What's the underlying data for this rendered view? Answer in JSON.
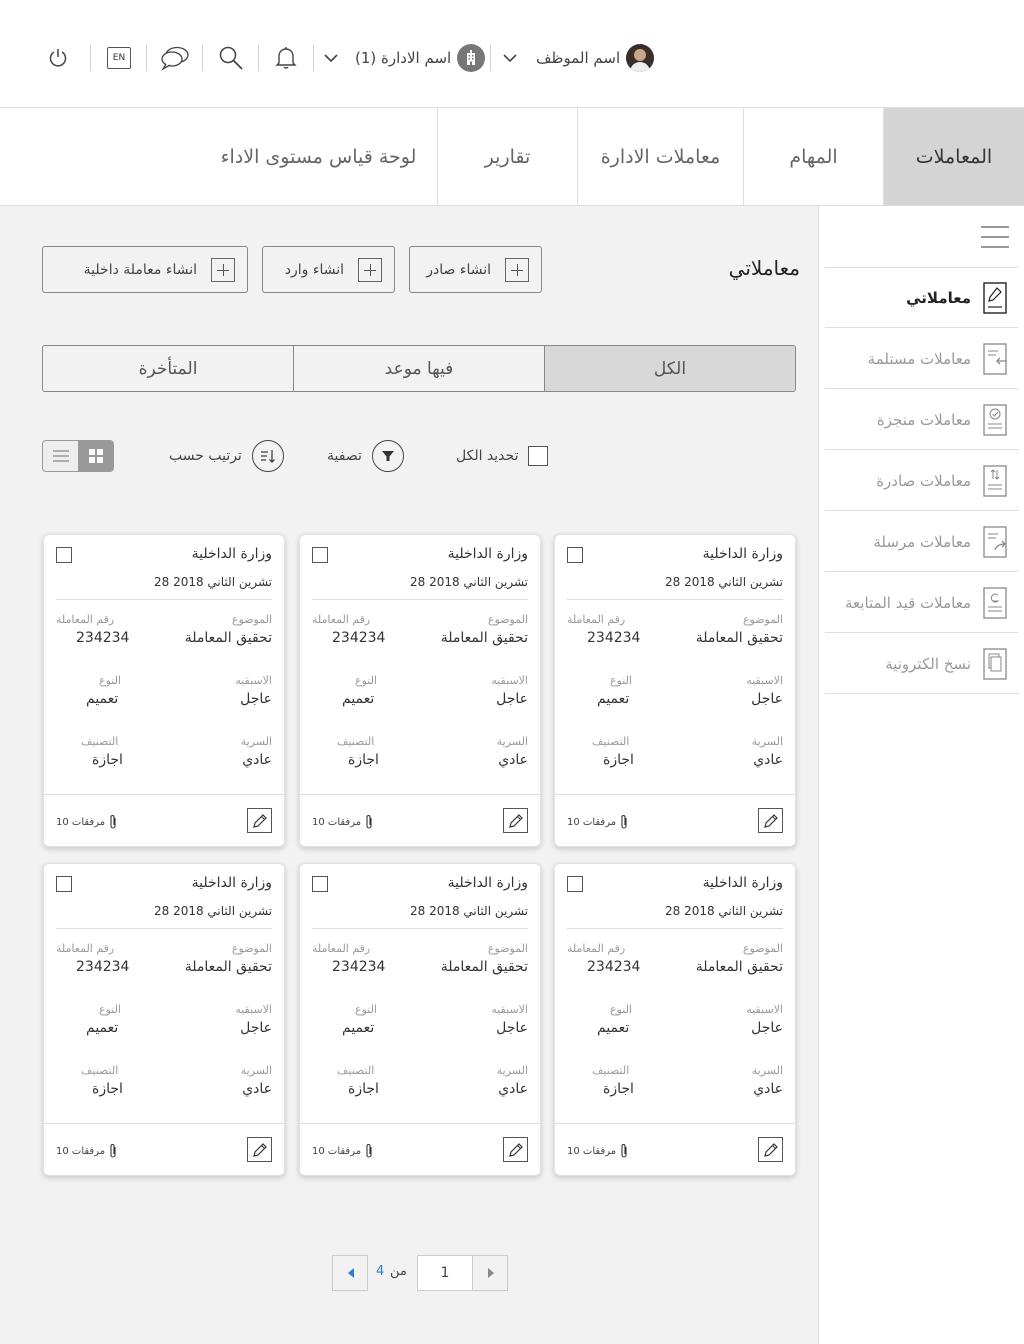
{
  "header": {
    "employee_name": "اسم الموظف",
    "department_name": "اسم الادارة (1)",
    "language": "EN"
  },
  "main_tabs": [
    {
      "label": "المعاملات",
      "active": true
    },
    {
      "label": "المهام",
      "active": false
    },
    {
      "label": "معاملات الادارة",
      "active": false
    },
    {
      "label": "تقارير",
      "active": false
    },
    {
      "label": "لوحة قياس مستوى الاداء",
      "active": false
    }
  ],
  "sidebar": {
    "items": [
      {
        "label": "معاملاتي",
        "icon": "document-edit-icon",
        "active": true
      },
      {
        "label": "معاملات مستلمة",
        "icon": "document-received-icon",
        "active": false
      },
      {
        "label": "معاملات منجزة",
        "icon": "document-check-icon",
        "active": false
      },
      {
        "label": "معاملات صادرة",
        "icon": "document-outgoing-icon",
        "active": false
      },
      {
        "label": "معاملات مرسلة",
        "icon": "document-sent-icon",
        "active": false
      },
      {
        "label": "معاملات قيد المتابعة",
        "icon": "document-followup-icon",
        "active": false
      },
      {
        "label": "نسخ الكترونية",
        "icon": "document-copy-icon",
        "active": false
      }
    ]
  },
  "content": {
    "title": "معاملاتي",
    "create_buttons": {
      "outgoing": "انشاء صادر",
      "incoming": "انشاء وارد",
      "internal": "انشاء معاملة داخلية"
    },
    "filters": [
      {
        "label": "الكل",
        "active": true
      },
      {
        "label": "فيها موعد",
        "active": false
      },
      {
        "label": "المتأخرة",
        "active": false
      }
    ],
    "toolbar": {
      "select_all": "تحديد الكل",
      "filter": "تصفية",
      "sort_by": "ترتيب حسب",
      "view": "grid"
    }
  },
  "card_labels": {
    "subject": "الموضوع",
    "number": "رقم المعاملة",
    "priority": "الاسبقيه",
    "type": "النوع",
    "secrecy": "السرية",
    "classification": "التصنيف"
  },
  "cards": [
    {
      "org": "وزارة الداخلية",
      "date": "28 تشرين الثاني 2018",
      "subject": "تحقيق المعاملة",
      "number": "234234",
      "priority": "عاجل",
      "type": "تعميم",
      "secrecy": "عادي",
      "classification": "اجازة",
      "attachments": "10 مرفقات"
    },
    {
      "org": "وزارة الداخلية",
      "date": "28 تشرين الثاني 2018",
      "subject": "تحقيق المعاملة",
      "number": "234234",
      "priority": "عاجل",
      "type": "تعميم",
      "secrecy": "عادي",
      "classification": "اجازة",
      "attachments": "10 مرفقات"
    },
    {
      "org": "وزارة الداخلية",
      "date": "28 تشرين الثاني 2018",
      "subject": "تحقيق المعاملة",
      "number": "234234",
      "priority": "عاجل",
      "type": "تعميم",
      "secrecy": "عادي",
      "classification": "اجازة",
      "attachments": "10 مرفقات"
    },
    {
      "org": "وزارة الداخلية",
      "date": "28 تشرين الثاني 2018",
      "subject": "تحقيق المعاملة",
      "number": "234234",
      "priority": "عاجل",
      "type": "تعميم",
      "secrecy": "عادي",
      "classification": "اجازة",
      "attachments": "10 مرفقات"
    },
    {
      "org": "وزارة الداخلية",
      "date": "28 تشرين الثاني 2018",
      "subject": "تحقيق المعاملة",
      "number": "234234",
      "priority": "عاجل",
      "type": "تعميم",
      "secrecy": "عادي",
      "classification": "اجازة",
      "attachments": "10 مرفقات"
    },
    {
      "org": "وزارة الداخلية",
      "date": "28 تشرين الثاني 2018",
      "subject": "تحقيق المعاملة",
      "number": "234234",
      "priority": "عاجل",
      "type": "تعميم",
      "secrecy": "عادي",
      "classification": "اجازة",
      "attachments": "10 مرفقات"
    }
  ],
  "pagination": {
    "current_page": "1",
    "of_label": "من",
    "total_pages": "4"
  },
  "colors": {
    "active_tab": "#d4d4d4",
    "page_background": "#f2f2f2",
    "pagination_accent": "#2e7bd6"
  }
}
